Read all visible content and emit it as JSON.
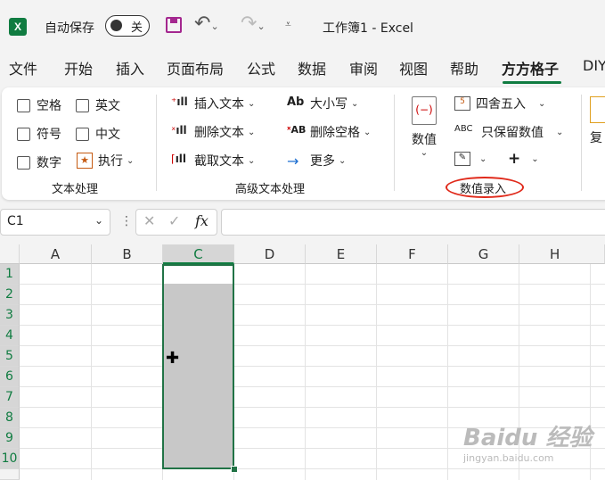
{
  "titlebar": {
    "app_logo": "X",
    "autosave_label": "自动保存",
    "autosave_state": "关",
    "doc_title": "工作簿1  -  Excel"
  },
  "tabs": [
    {
      "label": "文件"
    },
    {
      "label": "开始"
    },
    {
      "label": "插入"
    },
    {
      "label": "页面布局"
    },
    {
      "label": "公式"
    },
    {
      "label": "数据"
    },
    {
      "label": "审阅"
    },
    {
      "label": "视图"
    },
    {
      "label": "帮助"
    },
    {
      "label": "方方格子"
    },
    {
      "label": "DIY"
    }
  ],
  "ribbon": {
    "text_group": {
      "label": "文本处理",
      "checkboxes": [
        "空格",
        "英文",
        "符号",
        "中文",
        "数字"
      ],
      "execute_label": "执行"
    },
    "advanced_group": {
      "label": "高级文本处理",
      "insert_text": "插入文本",
      "delete_text": "删除文本",
      "extract_text": "截取文本",
      "case_label": "大小写",
      "delete_space": "删除空格",
      "more_label": "更多"
    },
    "number_group": {
      "label": "数值录入",
      "number_big": "数值",
      "round_label": "四舍五入",
      "keep_value": "只保留数值",
      "plus_label": "+"
    },
    "next_group_partial": "复"
  },
  "formula_bar": {
    "name_box": "C1",
    "fx_label": "fx",
    "formula": ""
  },
  "grid": {
    "columns": [
      "A",
      "B",
      "C",
      "D",
      "E",
      "F",
      "G",
      "H"
    ],
    "rows": [
      "1",
      "2",
      "3",
      "4",
      "5",
      "6",
      "7",
      "8",
      "9",
      "10"
    ],
    "selected_column": "C"
  },
  "watermark": {
    "main": "Baidu 经验",
    "sub": "jingyan.baidu.com"
  },
  "colors": {
    "accent": "#107c41",
    "highlight_oval": "#e02a1b",
    "selection_fill": "#c8c8c8"
  }
}
